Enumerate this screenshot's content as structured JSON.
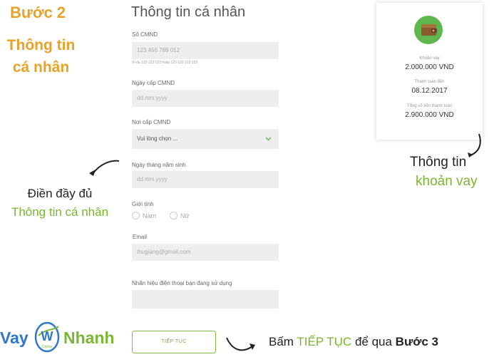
{
  "step": {
    "title": "Bước 2",
    "sub_line1": "Thông tin",
    "sub_line2": "cá nhân"
  },
  "left_note": {
    "line1": "Điền đầy đủ",
    "line2": "Thông tin cá nhân"
  },
  "form": {
    "title": "Thông tin cá nhân",
    "id_number": {
      "label": "Số CMND",
      "placeholder": "123 456 789 012",
      "hint": "Ví dụ 123 123 123 hoặc 123 123 123 123"
    },
    "issue_date": {
      "label": "Ngày cấp CMND",
      "placeholder": "dd.mm.yyyy"
    },
    "issue_place": {
      "label": "Nơi cấp CMND",
      "value": "Vui lòng chọn ..."
    },
    "birth_date": {
      "label": "Ngày tháng năm sinh",
      "placeholder": "dd.mm.yyyy"
    },
    "gender": {
      "label": "Giới tính",
      "options": [
        "Nam",
        "Nữ"
      ]
    },
    "email": {
      "label": "Email",
      "placeholder": "thugiang@gmail.com"
    },
    "phone_brand": {
      "label": "Nhãn hiệu điện thoại bạn đang sử dụng",
      "placeholder": ""
    },
    "submit_label": "TIẾP TỤC"
  },
  "loan_card": {
    "amount_label": "Khoản vay",
    "amount_value": "2.000.000 VND",
    "due_label": "Thanh toán đến",
    "due_value": "08.12.2017",
    "total_label": "Tổng số tiền thanh toán",
    "total_value": "2.900.000 VND",
    "icon": "wallet-icon",
    "icon_bg": "#5fb84f"
  },
  "right_note": {
    "line1": "Thông tin",
    "line2": "khoản vay"
  },
  "logo": {
    "left": "Vay",
    "right": "Nhanh",
    "mark": "W",
    "mark_sub": "Online"
  },
  "bottom_note": {
    "prefix": "Bấm ",
    "highlight": "TIẾP TỤC",
    "middle": " để qua ",
    "bold": "Bước 3"
  },
  "colors": {
    "accent_orange": "#e9a227",
    "accent_green": "#79b62d",
    "logo_blue": "#2f77c8"
  }
}
